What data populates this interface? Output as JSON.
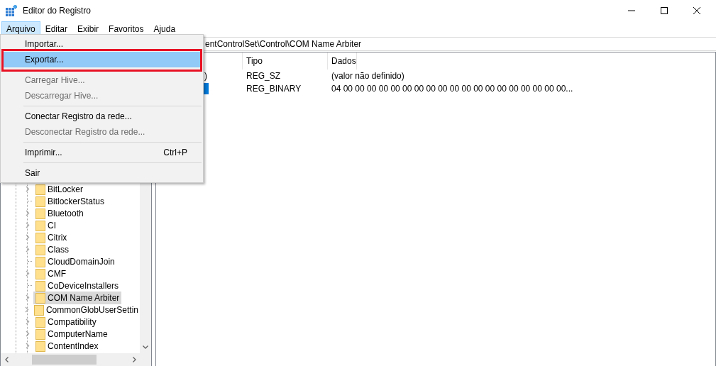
{
  "window": {
    "title": "Editor do Registro"
  },
  "menu_bar": [
    {
      "label": "Arquivo",
      "selected": true
    },
    {
      "label": "Editar",
      "selected": false
    },
    {
      "label": "Exibir",
      "selected": false
    },
    {
      "label": "Favoritos",
      "selected": false
    },
    {
      "label": "Ajuda",
      "selected": false
    }
  ],
  "menu": {
    "items": [
      {
        "kind": "item",
        "label": "Importar...",
        "disabled": false,
        "selected": false,
        "marked": false
      },
      {
        "kind": "item",
        "label": "Exportar...",
        "disabled": false,
        "selected": true,
        "marked": true
      },
      {
        "kind": "separator"
      },
      {
        "kind": "item",
        "label": "Carregar Hive...",
        "disabled": true,
        "selected": false,
        "marked": false
      },
      {
        "kind": "item",
        "label": "Descarregar Hive...",
        "disabled": true,
        "selected": false,
        "marked": false
      },
      {
        "kind": "separator"
      },
      {
        "kind": "item",
        "label": "Conectar Registro da rede...",
        "disabled": false,
        "selected": false,
        "marked": false
      },
      {
        "kind": "item",
        "label": "Desconectar Registro da rede...",
        "disabled": true,
        "selected": false,
        "marked": false
      },
      {
        "kind": "separator"
      },
      {
        "kind": "item",
        "label": "Imprimir...",
        "shortcut": "Ctrl+P",
        "disabled": false,
        "selected": false,
        "marked": false
      },
      {
        "kind": "separator"
      },
      {
        "kind": "item",
        "label": "Sair",
        "disabled": false,
        "selected": false,
        "marked": false
      }
    ]
  },
  "address_bar": {
    "value": "entControlSet\\Control\\COM Name Arbiter"
  },
  "tree": {
    "items": [
      {
        "label": "BitLocker",
        "has_children": true,
        "selected": false
      },
      {
        "label": "BitlockerStatus",
        "has_children": false,
        "selected": false
      },
      {
        "label": "Bluetooth",
        "has_children": true,
        "selected": false
      },
      {
        "label": "CI",
        "has_children": true,
        "selected": false
      },
      {
        "label": "Citrix",
        "has_children": true,
        "selected": false
      },
      {
        "label": "Class",
        "has_children": true,
        "selected": false
      },
      {
        "label": "CloudDomainJoin",
        "has_children": false,
        "selected": false
      },
      {
        "label": "CMF",
        "has_children": true,
        "selected": false
      },
      {
        "label": "CoDeviceInstallers",
        "has_children": false,
        "selected": false
      },
      {
        "label": "COM Name Arbiter",
        "has_children": true,
        "selected": true
      },
      {
        "label": "CommonGlobUserSettin",
        "has_children": true,
        "selected": false
      },
      {
        "label": "Compatibility",
        "has_children": true,
        "selected": false
      },
      {
        "label": "ComputerName",
        "has_children": true,
        "selected": false
      },
      {
        "label": "ContentIndex",
        "has_children": true,
        "selected": false
      }
    ]
  },
  "list": {
    "columns": [
      {
        "label": "Tipo"
      },
      {
        "label": "Dados"
      }
    ],
    "rows": [
      {
        "name": ")",
        "type": "REG_SZ",
        "data": "(valor não definido)",
        "selected": false
      },
      {
        "type": "REG_BINARY",
        "data": "04 00 00 00 00 00 00 00 00 00 00 00 00 00 00 00 00 00 00 00...",
        "selected": true
      }
    ]
  }
}
